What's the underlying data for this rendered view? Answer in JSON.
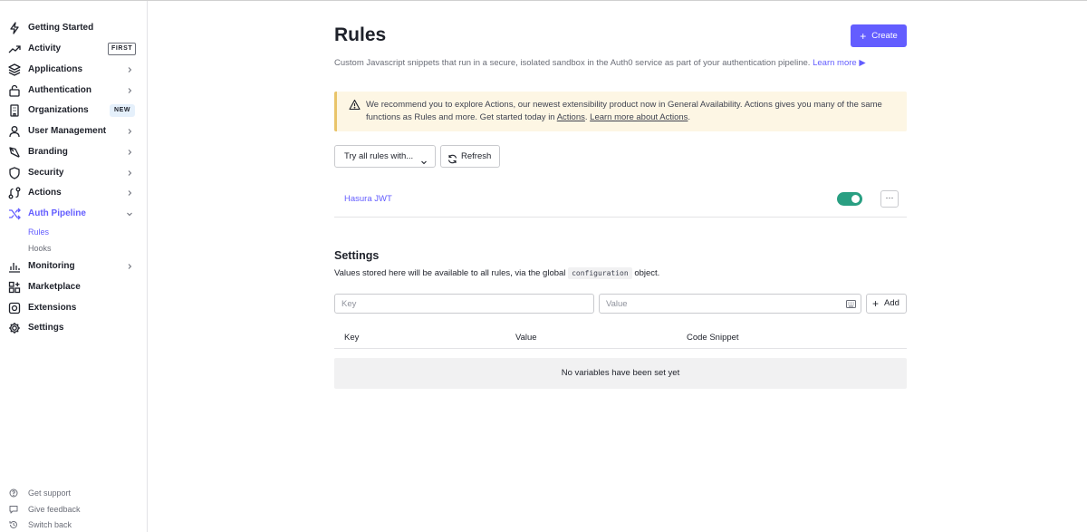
{
  "sidebar": {
    "items": [
      {
        "label": "Getting Started",
        "icon": "bolt-icon"
      },
      {
        "label": "Activity",
        "icon": "trend-icon",
        "badge": "FIRST"
      },
      {
        "label": "Applications",
        "icon": "layers-icon"
      },
      {
        "label": "Authentication",
        "icon": "lock-icon"
      },
      {
        "label": "Organizations",
        "icon": "building-icon",
        "badge": "NEW"
      },
      {
        "label": "User Management",
        "icon": "user-icon"
      },
      {
        "label": "Branding",
        "icon": "pen-icon"
      },
      {
        "label": "Security",
        "icon": "shield-icon"
      },
      {
        "label": "Actions",
        "icon": "actions-icon"
      },
      {
        "label": "Auth Pipeline",
        "icon": "pipeline-icon"
      },
      {
        "label": "Monitoring",
        "icon": "chart-icon"
      },
      {
        "label": "Marketplace",
        "icon": "grid-plus-icon"
      },
      {
        "label": "Extensions",
        "icon": "plug-icon"
      },
      {
        "label": "Settings",
        "icon": "gear-icon"
      }
    ],
    "sub_items": [
      "Rules",
      "Hooks"
    ],
    "footer": [
      {
        "label": "Get support",
        "icon": "help-icon"
      },
      {
        "label": "Give feedback",
        "icon": "comment-icon"
      },
      {
        "label": "Switch back",
        "icon": "history-icon"
      }
    ]
  },
  "header": {
    "title": "Rules",
    "create_label": "Create",
    "subtitle": "Custom Javascript snippets that run in a secure, isolated sandbox in the Auth0 service as part of your authentication pipeline.",
    "learn_more": "Learn more ▶"
  },
  "alert": {
    "text_1": "We recommend you to explore Actions, our newest extensibility product now in General Availability. Actions gives you many of the same functions as Rules and more. Get started today in",
    "link_1": "Actions",
    "sep": ".",
    "link_2": "Learn more about Actions",
    "end": "."
  },
  "toolbar": {
    "try_label": "Try all rules with...",
    "refresh_label": "Refresh"
  },
  "rules": [
    {
      "name": "Hasura JWT",
      "enabled": true
    }
  ],
  "settings": {
    "title": "Settings",
    "desc_before": "Values stored here will be available to all rules, via the global",
    "desc_code": "configuration",
    "desc_after": "object.",
    "key_placeholder": "Key",
    "value_placeholder": "Value",
    "add_label": "Add",
    "columns": [
      "Key",
      "Value",
      "Code Snippet"
    ],
    "empty_text": "No variables have been set yet"
  },
  "colors": {
    "accent": "#635dff",
    "toggle_on": "#299f82",
    "alert_bg": "#fdf6e4",
    "alert_border": "#e9c46a"
  }
}
